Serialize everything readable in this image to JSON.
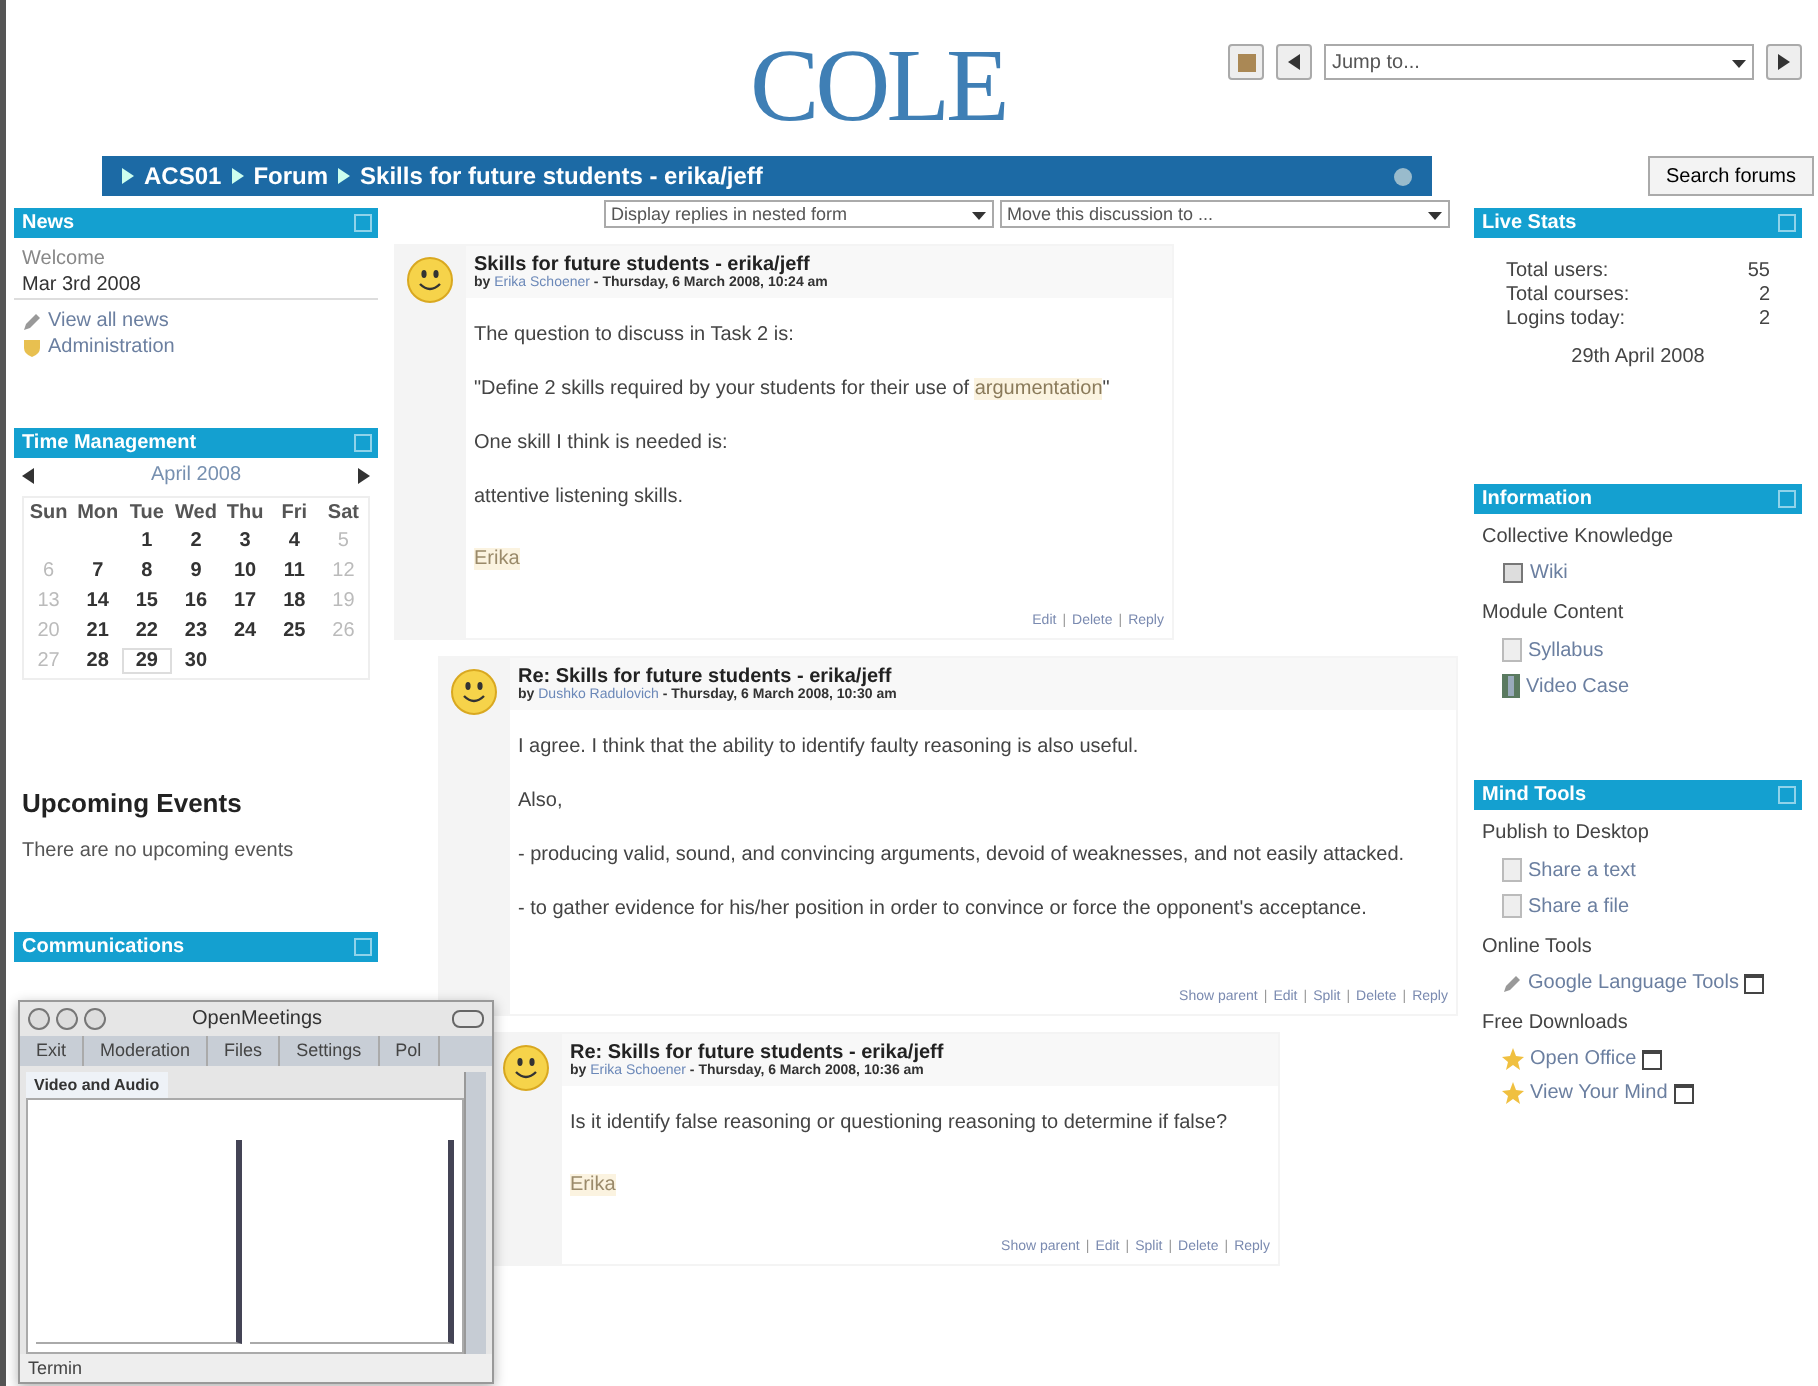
{
  "header": {
    "logo": "COLE",
    "jump_placeholder": "Jump to..."
  },
  "breadcrumb": {
    "items": [
      "ACS01",
      "Forum",
      "Skills for future students - erika/jeff"
    ],
    "search_button": "Search forums"
  },
  "news": {
    "title": "News",
    "lines": [
      "Welcome",
      "Mar 3rd 2008"
    ],
    "links": [
      {
        "label": "View all news",
        "kind": "pencil"
      },
      {
        "label": "Administration",
        "kind": "shield"
      }
    ]
  },
  "calendar": {
    "title": "Time Management",
    "month": "April 2008",
    "weekdays": [
      "Sun",
      "Mon",
      "Tue",
      "Wed",
      "Thu",
      "Fri",
      "Sat"
    ],
    "weeks": [
      [
        {
          "kind": "blank"
        },
        {
          "kind": "blank"
        },
        {
          "day": "1",
          "weekend": false,
          "today": false
        },
        {
          "day": "2",
          "weekend": false,
          "today": false
        },
        {
          "day": "3",
          "weekend": false,
          "today": false
        },
        {
          "day": "4",
          "weekend": false,
          "today": false
        },
        {
          "day": "5",
          "weekend": true,
          "today": false
        }
      ],
      [
        {
          "day": "6",
          "weekend": true,
          "today": false
        },
        {
          "day": "7",
          "weekend": false,
          "today": false
        },
        {
          "day": "8",
          "weekend": false,
          "today": false
        },
        {
          "day": "9",
          "weekend": false,
          "today": false
        },
        {
          "day": "10",
          "weekend": false,
          "today": false
        },
        {
          "day": "11",
          "weekend": false,
          "today": false
        },
        {
          "day": "12",
          "weekend": true,
          "today": false
        }
      ],
      [
        {
          "day": "13",
          "weekend": true,
          "today": false
        },
        {
          "day": "14",
          "weekend": false,
          "today": false
        },
        {
          "day": "15",
          "weekend": false,
          "today": false
        },
        {
          "day": "16",
          "weekend": false,
          "today": false
        },
        {
          "day": "17",
          "weekend": false,
          "today": false
        },
        {
          "day": "18",
          "weekend": false,
          "today": false
        },
        {
          "day": "19",
          "weekend": true,
          "today": false
        }
      ],
      [
        {
          "day": "20",
          "weekend": true,
          "today": false
        },
        {
          "day": "21",
          "weekend": false,
          "today": false
        },
        {
          "day": "22",
          "weekend": false,
          "today": false
        },
        {
          "day": "23",
          "weekend": false,
          "today": false
        },
        {
          "day": "24",
          "weekend": false,
          "today": false
        },
        {
          "day": "25",
          "weekend": false,
          "today": false
        },
        {
          "day": "26",
          "weekend": true,
          "today": false
        }
      ],
      [
        {
          "day": "27",
          "weekend": true,
          "today": false
        },
        {
          "day": "28",
          "weekend": false,
          "today": false
        },
        {
          "day": "29",
          "weekend": false,
          "today": true
        },
        {
          "day": "30",
          "weekend": false,
          "today": false
        }
      ]
    ]
  },
  "upcoming": {
    "title": "Upcoming Events",
    "text": "There are no upcoming events"
  },
  "communications": {
    "title": "Communications"
  },
  "selects": [
    "Display replies in nested form",
    "Move this discussion to ..."
  ],
  "command_separator": "|",
  "posts": [
    {
      "title": "Skills for future students - erika/jeff",
      "by": "by",
      "author": "Erika Schoener",
      "date": " - Thursday, 6 March 2008, 10:24 am",
      "paragraphs": [
        {
          "text": "The question to discuss in Task 2 is:"
        },
        {
          "text": "\"Define 2 skills required by your students for their use of ",
          "link": "argumentation",
          "after": "\""
        },
        {
          "text": "One skill I think is needed is:"
        },
        {
          "text": "attentive listening skills."
        }
      ],
      "signature": "Erika",
      "links": [
        "Edit",
        "Delete",
        "Reply"
      ],
      "children": [
        {
          "title": "Re: Skills for future students - erika/jeff",
          "by": "by",
          "author": "Dushko Radulovich",
          "date": " - Thursday, 6 March 2008, 10:30 am",
          "paragraphs": [
            {
              "text": "I agree. I think that the ability to identify faulty reasoning is also useful."
            },
            {
              "text": "Also,"
            },
            {
              "text": "- producing valid, sound, and convincing arguments, devoid of weaknesses, and not easily attacked."
            },
            {
              "text": "- to gather evidence for his/her position in order to convince or force the opponent's acceptance."
            }
          ],
          "links": [
            "Show parent",
            "Edit",
            "Split",
            "Delete",
            "Reply"
          ],
          "children": [
            {
              "title": "Re: Skills for future students - erika/jeff",
              "by": "by",
              "author": "Erika Schoener",
              "date": " - Thursday, 6 March 2008, 10:36 am",
              "paragraphs": [
                {
                  "text": "Is it identify false reasoning or questioning reasoning to determine if false?"
                }
              ],
              "signature": "Erika",
              "links": [
                "Show parent",
                "Edit",
                "Split",
                "Delete",
                "Reply"
              ]
            }
          ]
        }
      ]
    }
  ],
  "live_stats": {
    "title": "Live Stats",
    "rows": [
      {
        "label": "Total users:",
        "value": "55"
      },
      {
        "label": "Total courses:",
        "value": "2"
      },
      {
        "label": "Logins today:",
        "value": "2"
      }
    ],
    "date": "29th April 2008"
  },
  "information": {
    "title": "Information",
    "sections": [
      {
        "heading": "Collective Knowledge",
        "items": [
          {
            "label": "Wiki",
            "kind": "wiki"
          }
        ]
      },
      {
        "heading": "Module Content",
        "items": [
          {
            "label": "Syllabus",
            "kind": "page"
          },
          {
            "label": "Video Case",
            "kind": "film"
          }
        ]
      }
    ]
  },
  "mind_tools": {
    "title": "Mind Tools",
    "sections": [
      {
        "heading": "Publish to Desktop",
        "items": [
          {
            "label": "Share a text",
            "kind": "page",
            "external": false
          },
          {
            "label": "Share a file",
            "kind": "page",
            "external": false
          }
        ]
      },
      {
        "heading": "Online Tools",
        "items": [
          {
            "label": "Google Language Tools",
            "kind": "pencil",
            "external": true
          }
        ]
      },
      {
        "heading": "Free Downloads",
        "items": [
          {
            "label": "Open Office",
            "kind": "star",
            "external": true
          },
          {
            "label": "View Your Mind",
            "kind": "star",
            "external": true
          }
        ]
      }
    ]
  },
  "meetings": {
    "title": "OpenMeetings",
    "menu": [
      "Exit",
      "Moderation",
      "Files",
      "Settings",
      "Pol"
    ],
    "tab": "Video and Audio",
    "status": "Termin"
  }
}
